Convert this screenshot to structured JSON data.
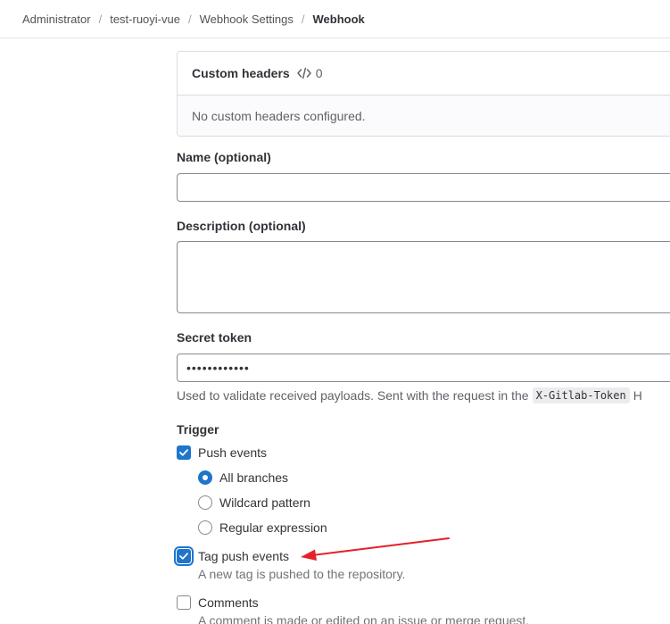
{
  "breadcrumb": {
    "items": [
      "Administrator",
      "test-ruoyi-vue",
      "Webhook Settings",
      "Webhook"
    ],
    "separator": "/"
  },
  "custom_headers": {
    "title": "Custom headers",
    "count": "0",
    "empty_message": "No custom headers configured."
  },
  "form": {
    "name_label": "Name (optional)",
    "name_value": "",
    "description_label": "Description (optional)",
    "description_value": "",
    "secret_label": "Secret token",
    "secret_value": "••••••••••••",
    "secret_help_prefix": "Used to validate received payloads. Sent with the request in the",
    "secret_help_code": "X-Gitlab-Token",
    "secret_help_suffix": "H"
  },
  "trigger": {
    "label": "Trigger",
    "push_events": {
      "label": "Push events",
      "checked": true
    },
    "branch_options": [
      {
        "label": "All branches",
        "selected": true
      },
      {
        "label": "Wildcard pattern",
        "selected": false
      },
      {
        "label": "Regular expression",
        "selected": false
      }
    ],
    "tag_push_events": {
      "label": "Tag push events",
      "checked": true,
      "description": "A new tag is pushed to the repository."
    },
    "comments": {
      "label": "Comments",
      "checked": false,
      "description": "A comment is made or edited on an issue or merge request."
    }
  },
  "colors": {
    "accent": "#1f75cb",
    "annotation_arrow": "#e5202a"
  },
  "icons": {
    "custom_headers": "code-icon",
    "check": "check-icon"
  }
}
